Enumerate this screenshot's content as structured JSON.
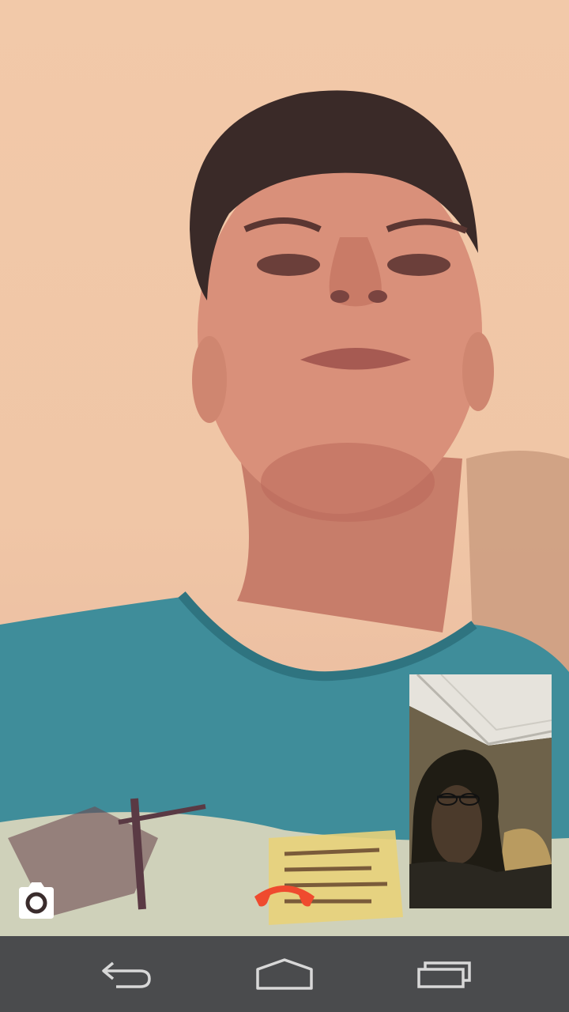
{
  "call": {
    "remote_video": "remote-participant-video",
    "local_video": "self-view-preview"
  },
  "controls": {
    "camera_icon": "camera-switch-icon",
    "end_call_icon": "end-call-icon",
    "end_call_color": "#ef4a2e"
  },
  "navigation": {
    "items": [
      {
        "icon": "back-icon"
      },
      {
        "icon": "home-icon"
      },
      {
        "icon": "recent-apps-icon"
      }
    ],
    "background": "#4a4b4d"
  }
}
